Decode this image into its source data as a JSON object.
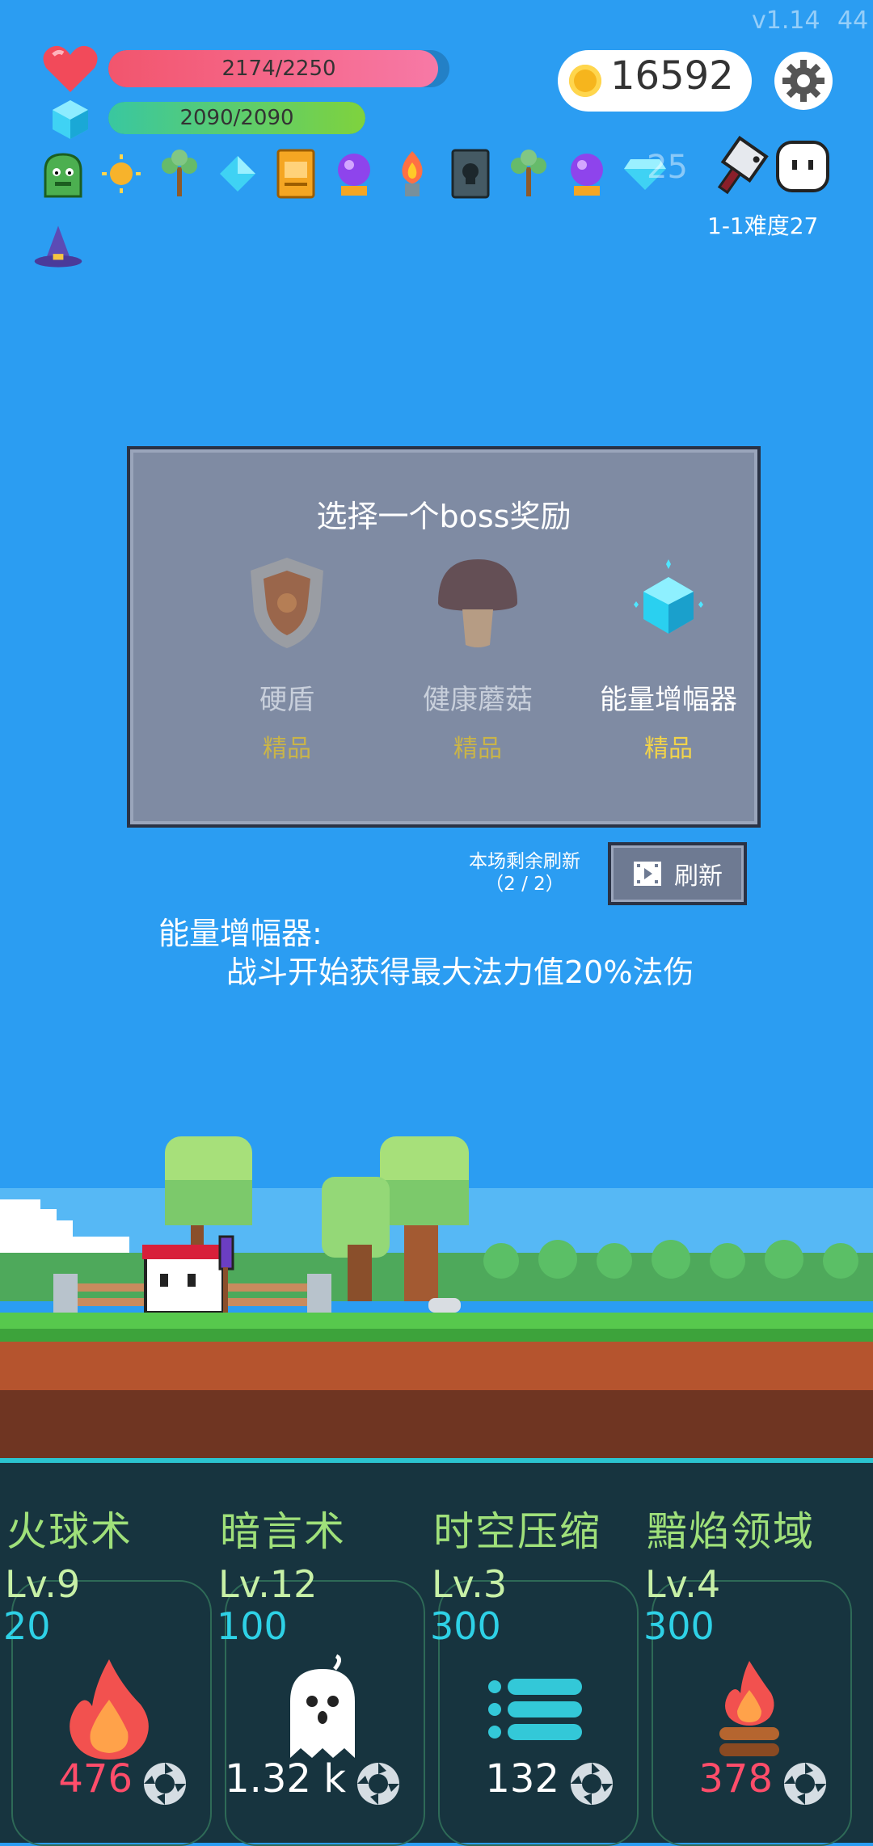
{
  "hud": {
    "version": "v1.14",
    "fps": "44",
    "hp_text": "2174/2250",
    "hp_fraction": 0.966,
    "mp_text": "2090/2090",
    "mp_fraction": 1.0,
    "coins": "16592",
    "level_text": "1-1难度27",
    "item_count": "25",
    "items": [
      "green-slime",
      "sun",
      "sapling",
      "cyan-gem",
      "spell-book",
      "purple-orb",
      "flame-torch",
      "skull-tome",
      "sapling",
      "purple-orb",
      "diamond",
      "wizard-hat"
    ]
  },
  "modal": {
    "title": "选择一个boss奖励",
    "rewards": [
      {
        "name": "硬盾",
        "rank": "精品",
        "icon": "shield-icon",
        "selected": false
      },
      {
        "name": "健康蘑菇",
        "rank": "精品",
        "icon": "mushroom-icon",
        "selected": false
      },
      {
        "name": "能量增幅器",
        "rank": "精品",
        "icon": "energy-crystal-icon",
        "selected": true
      }
    ]
  },
  "refresh": {
    "info_line1": "本场剩余刷新",
    "info_line2": "（2 / 2）",
    "button_label": "刷新"
  },
  "description": {
    "title": "能量增幅器:",
    "text": "战斗开始获得最大法力值20%法伤"
  },
  "skills": [
    {
      "name": "火球术",
      "level": "Lv.9",
      "cost": "20",
      "damage": "476",
      "damage_color": "#ff4d6a",
      "icon": "fire-icon"
    },
    {
      "name": "暗言术",
      "level": "Lv.12",
      "cost": "100",
      "damage": "1.32 k",
      "damage_color": "#ffffff",
      "icon": "ghost-icon"
    },
    {
      "name": "时空压缩",
      "level": "Lv.3",
      "cost": "300",
      "damage": "132",
      "damage_color": "#ffffff",
      "icon": "list-icon"
    },
    {
      "name": "黯焰领域",
      "level": "Lv.4",
      "cost": "300",
      "damage": "378",
      "damage_color": "#ff4d6a",
      "icon": "campfire-icon"
    }
  ],
  "colors": {
    "sky": "#2b9df2",
    "hp": "#f1607a",
    "mp": "#4fc97a",
    "rank": "#f1d34a",
    "panel": "#17343f"
  }
}
